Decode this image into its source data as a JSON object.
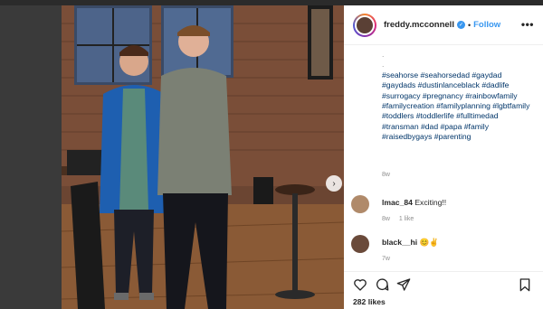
{
  "post": {
    "username": "freddy.mcconnell",
    "follow_label": "Follow",
    "more_label": "•••",
    "caption_dots": [
      ".",
      "."
    ],
    "caption_tags": "#seahorse #seahorsedad #gaydad #gaydads #dustinlanceblack #dadlife #surrogacy #pregnancy #rainbowfamily #familycreation #familyplanning #lgbtfamily #toddlers #toddlerlife #fulltimedad #transman #dad #papa #family #raisedbygays #parenting",
    "caption_time": "8w",
    "likes": "282 likes"
  },
  "comments": [
    {
      "user": "lmac_84",
      "text": "Exciting!!",
      "time": "8w",
      "likes": "1 like"
    },
    {
      "user": "black__hi",
      "text": "😊✌️",
      "time": "7w"
    }
  ],
  "icons": [
    "heart-icon",
    "comment-icon",
    "share-icon",
    "bookmark-icon",
    "next-arrow-icon",
    "verified-icon"
  ],
  "colors": {
    "link": "#3897f0",
    "hashtag": "#003569",
    "muted": "#8e8e8e",
    "text": "#262626"
  }
}
